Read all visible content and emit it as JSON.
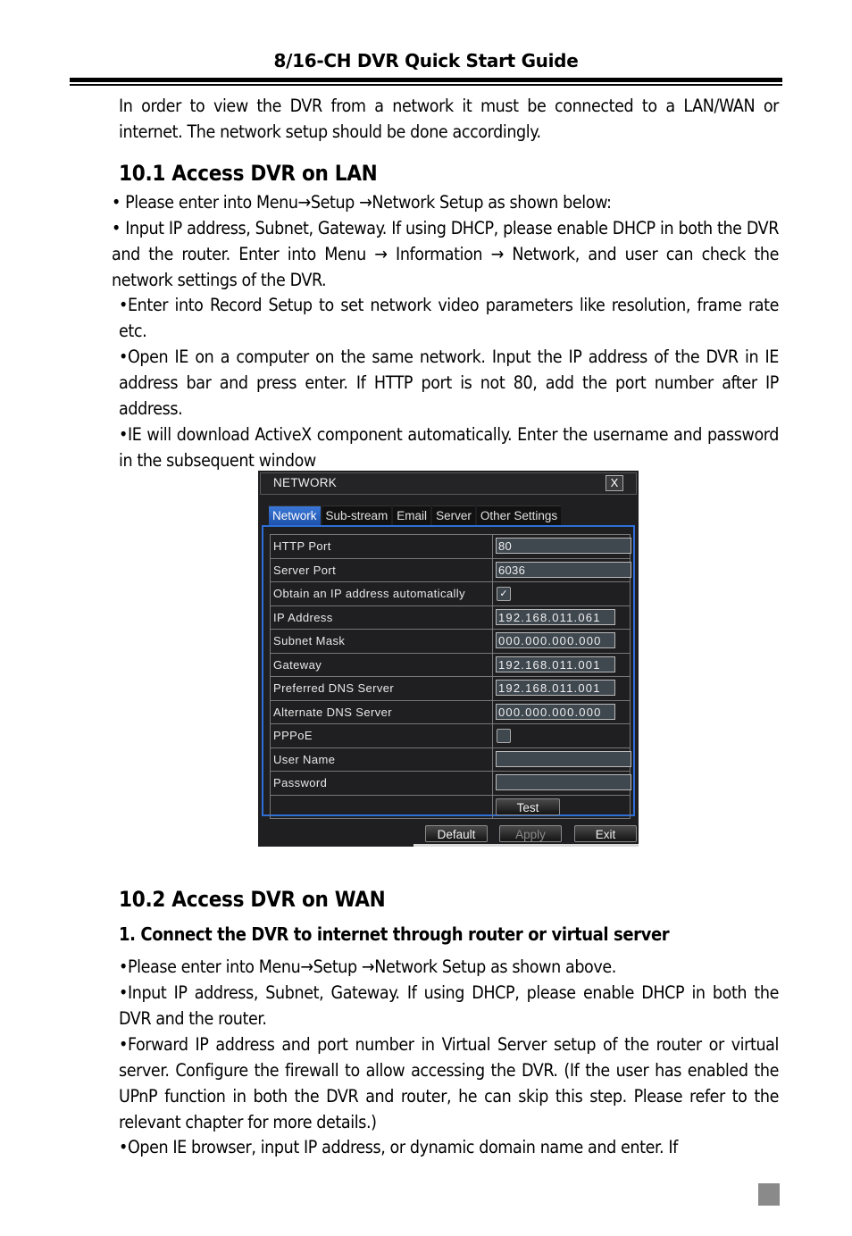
{
  "page": {
    "header": "8/16-CH DVR Quick Start Guide",
    "intro": "In order to view the DVR from a network it must be connected to a LAN/WAN or internet. The network setup should be done accordingly.",
    "section_lan": {
      "title": "10.1  Access DVR on LAN",
      "bullets": [
        "•  Please enter into Menu→Setup →Network Setup as shown below:",
        "•  Input IP address, Subnet, Gateway. If using DHCP, please enable DHCP in both the DVR and the router. Enter into    Menu → Information → Network, and user can check the network settings of the DVR.",
        "•Enter into Record Setup to set network video parameters like resolution, frame rate etc.",
        "•Open IE on a computer on the same network. Input the IP address of the DVR in IE address bar and press enter. If HTTP port is not 80, add the port number after IP address.",
        "•IE will download ActiveX component automatically. Enter the username and password in the subsequent window"
      ]
    },
    "section_wan": {
      "title": "10.2  Access DVR on WAN",
      "subtitle": "1. Connect the DVR to internet through router or virtual server",
      "bullets": [
        "•Please enter into Menu→Setup →Network Setup as shown above.",
        "•Input IP address, Subnet, Gateway. If using DHCP, please enable DHCP in both the DVR and the router.",
        "•Forward IP address and port number in Virtual Server setup of the router or virtual server. Configure the firewall to allow accessing the DVR. (If the user has enabled the UPnP function in both the DVR and router, he can skip this step. Please refer to the relevant chapter for more details.)",
        "•Open IE browser, input IP address, or dynamic domain name and enter. If"
      ]
    }
  },
  "dialog": {
    "title": "NETWORK",
    "close_icon": "X",
    "tabs": [
      {
        "label": "Network",
        "active": true
      },
      {
        "label": "Sub-stream"
      },
      {
        "label": "Email"
      },
      {
        "label": "Server"
      },
      {
        "label": "Other Settings"
      }
    ],
    "fields": {
      "http_port": {
        "label": "HTTP Port",
        "value": "80"
      },
      "server_port": {
        "label": "Server Port",
        "value": "6036"
      },
      "dhcp": {
        "label": "Obtain an IP address automatically",
        "checked": true,
        "mark": "✓"
      },
      "ip_address": {
        "label": "IP Address",
        "value": "192.168.011.061"
      },
      "subnet_mask": {
        "label": "Subnet Mask",
        "value": "000.000.000.000"
      },
      "gateway": {
        "label": "Gateway",
        "value": "192.168.011.001"
      },
      "preferred_dns": {
        "label": "Preferred DNS Server",
        "value": "192.168.011.001"
      },
      "alternate_dns": {
        "label": "Alternate DNS Server",
        "value": "000.000.000.000"
      },
      "pppoe": {
        "label": "PPPoE",
        "checked": false
      },
      "user_name": {
        "label": "User Name",
        "value": ""
      },
      "password": {
        "label": "Password",
        "value": ""
      }
    },
    "buttons": {
      "test": "Test",
      "default": "Default",
      "apply": "Apply",
      "exit": "Exit"
    },
    "colors": {
      "accent": "#2d6fd6",
      "background": "#1f1f21"
    }
  }
}
